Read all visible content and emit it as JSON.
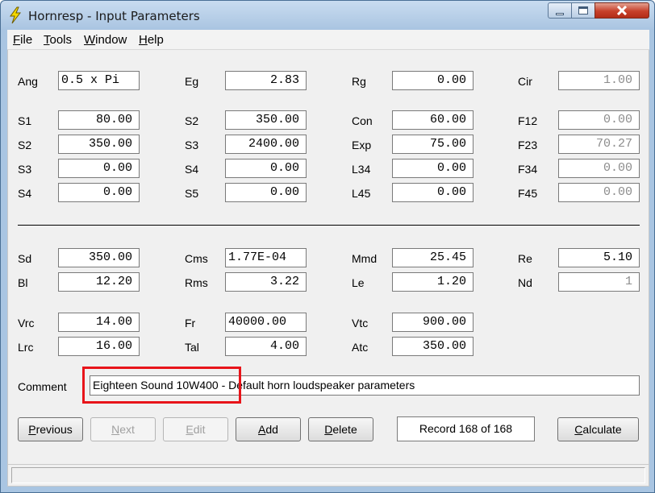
{
  "window": {
    "title": "Hornresp - Input Parameters"
  },
  "menu": [
    {
      "first": "F",
      "rest": "ile"
    },
    {
      "first": "T",
      "rest": "ools"
    },
    {
      "first": "W",
      "rest": "indow"
    },
    {
      "first": "H",
      "rest": "elp"
    }
  ],
  "horn": {
    "Ang": {
      "label": "Ang",
      "value": "0.5 x Pi"
    },
    "Eg": {
      "label": "Eg",
      "value": "2.83"
    },
    "Rg": {
      "label": "Rg",
      "value": "0.00"
    },
    "Cir": {
      "label": "Cir",
      "value": "1.00"
    },
    "S1": {
      "label": "S1",
      "value": "80.00"
    },
    "S2a": {
      "label": "S2",
      "value": "350.00"
    },
    "Con": {
      "label": "Con",
      "value": "60.00"
    },
    "F12": {
      "label": "F12",
      "value": "0.00"
    },
    "S2b": {
      "label": "S2",
      "value": "350.00"
    },
    "S3a": {
      "label": "S3",
      "value": "2400.00"
    },
    "Exp": {
      "label": "Exp",
      "value": "75.00"
    },
    "F23": {
      "label": "F23",
      "value": "70.27"
    },
    "S3b": {
      "label": "S3",
      "value": "0.00"
    },
    "S4a": {
      "label": "S4",
      "value": "0.00"
    },
    "L34": {
      "label": "L34",
      "value": "0.00"
    },
    "F34": {
      "label": "F34",
      "value": "0.00"
    },
    "S4b": {
      "label": "S4",
      "value": "0.00"
    },
    "S5": {
      "label": "S5",
      "value": "0.00"
    },
    "L45": {
      "label": "L45",
      "value": "0.00"
    },
    "F45": {
      "label": "F45",
      "value": "0.00"
    }
  },
  "driver": {
    "Sd": {
      "label": "Sd",
      "value": "350.00"
    },
    "Cms": {
      "label": "Cms",
      "value": "1.77E-04"
    },
    "Mmd": {
      "label": "Mmd",
      "value": "25.45"
    },
    "Re": {
      "label": "Re",
      "value": "5.10"
    },
    "Bl": {
      "label": "Bl",
      "value": "12.20"
    },
    "Rms": {
      "label": "Rms",
      "value": "3.22"
    },
    "Le": {
      "label": "Le",
      "value": "1.20"
    },
    "Nd": {
      "label": "Nd",
      "value": "1"
    },
    "Vrc": {
      "label": "Vrc",
      "value": "14.00"
    },
    "Fr": {
      "label": "Fr",
      "value": "40000.00"
    },
    "Vtc": {
      "label": "Vtc",
      "value": "900.00"
    },
    "Lrc": {
      "label": "Lrc",
      "value": "16.00"
    },
    "Tal": {
      "label": "Tal",
      "value": "4.00"
    },
    "Atc": {
      "label": "Atc",
      "value": "350.00"
    }
  },
  "comment": {
    "label": "Comment",
    "value": "Eighteen Sound 10W400 - Default horn loudspeaker parameters"
  },
  "buttons": {
    "previous": {
      "first": "P",
      "rest": "revious"
    },
    "next": {
      "first": "N",
      "rest": "ext"
    },
    "edit": {
      "first": "E",
      "rest": "dit"
    },
    "add": {
      "first": "A",
      "rest": "dd"
    },
    "delete": {
      "first": "D",
      "rest": "elete"
    },
    "calculate": {
      "first": "C",
      "rest": "alculate"
    }
  },
  "record": "Record 168 of 168",
  "colors": {
    "highlight": "#e8141a",
    "disabled_text": "#8c8c8c",
    "close_button": "#c7402a"
  }
}
